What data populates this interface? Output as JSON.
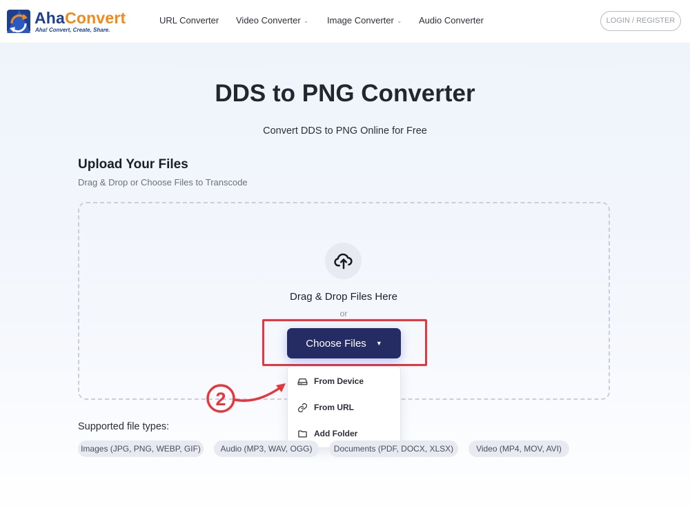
{
  "header": {
    "logo_primary": "Aha",
    "logo_secondary": "Convert",
    "logo_tagline": "Aha! Convert, Create, Share.",
    "nav": [
      {
        "label": "URL Converter",
        "has_dropdown": false
      },
      {
        "label": "Video Converter",
        "has_dropdown": true
      },
      {
        "label": "Image Converter",
        "has_dropdown": true
      },
      {
        "label": "Audio Converter",
        "has_dropdown": false
      }
    ],
    "login_label": "LOGIN / REGISTER"
  },
  "hero": {
    "title": "DDS to PNG Converter",
    "subtitle": "Convert DDS to PNG Online for Free"
  },
  "upload": {
    "heading": "Upload Your Files",
    "subheading": "Drag & Drop or Choose Files to Transcode",
    "drop_text": "Drag & Drop Files Here",
    "or_text": "or",
    "choose_label": "Choose Files",
    "menu": [
      {
        "label": "From Device",
        "icon": "drive-icon"
      },
      {
        "label": "From URL",
        "icon": "link-icon"
      },
      {
        "label": "Add Folder",
        "icon": "folder-icon"
      }
    ]
  },
  "annotation": {
    "step_number": "2",
    "color": "#e8363d"
  },
  "supported": {
    "label": "Supported file types:",
    "types": [
      "Images (JPG, PNG, WEBP, GIF)",
      "Audio (MP3, WAV, OGG)",
      "Documents (PDF, DOCX, XLSX)",
      "Video (MP4, MOV, AVI)"
    ]
  },
  "colors": {
    "brand_blue": "#1d3f8f",
    "brand_orange": "#f08a1c",
    "button_navy": "#252b63"
  }
}
